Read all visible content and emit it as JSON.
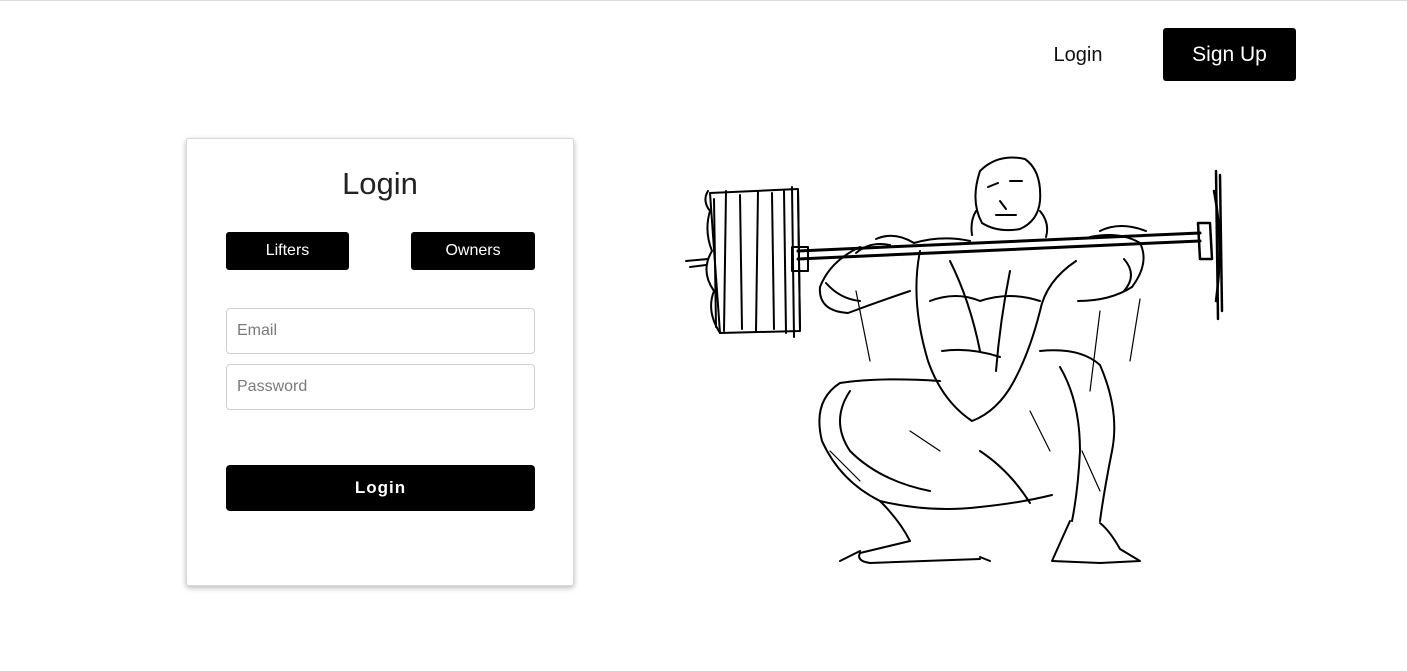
{
  "header": {
    "login_label": "Login",
    "signup_label": "Sign Up"
  },
  "card": {
    "title": "Login",
    "roles": {
      "lifters_label": "Lifters",
      "owners_label": "Owners"
    },
    "email": {
      "placeholder": "Email",
      "value": ""
    },
    "password": {
      "placeholder": "Password",
      "value": ""
    },
    "submit_label": "Login"
  },
  "illustration": {
    "icon": "squatting-weightlifter-sketch"
  },
  "colors": {
    "primary": "#000000",
    "background": "#ffffff",
    "text": "#222222"
  }
}
